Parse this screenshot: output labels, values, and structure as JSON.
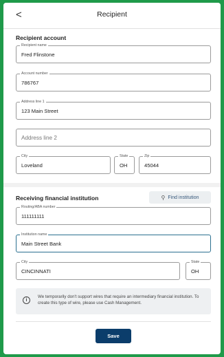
{
  "header": {
    "title": "Recipient",
    "back_glyph": "<"
  },
  "recipient_section": {
    "title": "Recipient account"
  },
  "fields": {
    "recipient_name": {
      "label": "Recipient name",
      "value": "Fred Flinstone"
    },
    "account_number": {
      "label": "Account number",
      "value": "786767"
    },
    "address_line_1": {
      "label": "Address line 1",
      "value": "123 Main Street"
    },
    "address_line_2": {
      "placeholder": "Address line 2"
    },
    "city": {
      "label": "City",
      "value": "Loveland"
    },
    "state": {
      "label": "State",
      "value": "OH"
    },
    "zip": {
      "label": "Zip",
      "value": "45044"
    },
    "routing": {
      "label": "Routing/ABA number",
      "value": "111111111"
    },
    "institution_name": {
      "label": "Institution name",
      "value": "Main Street Bank"
    },
    "inst_city": {
      "label": "City",
      "value": "CINCINNATI"
    },
    "inst_state": {
      "label": "State",
      "value": "OH"
    }
  },
  "institution_section": {
    "title": "Receiving financial institution",
    "find_button": "Find institution",
    "find_icon": "search-icon"
  },
  "info": {
    "icon": "info-icon",
    "text": "We temporarily don't support wires that require an intermediary financial institution. To create this type of wire, please use Cash Management."
  },
  "save_label": "Save",
  "colors": {
    "background": "#1f9a4a",
    "primary": "#0b3d6b",
    "focus": "#2a6f8f"
  }
}
